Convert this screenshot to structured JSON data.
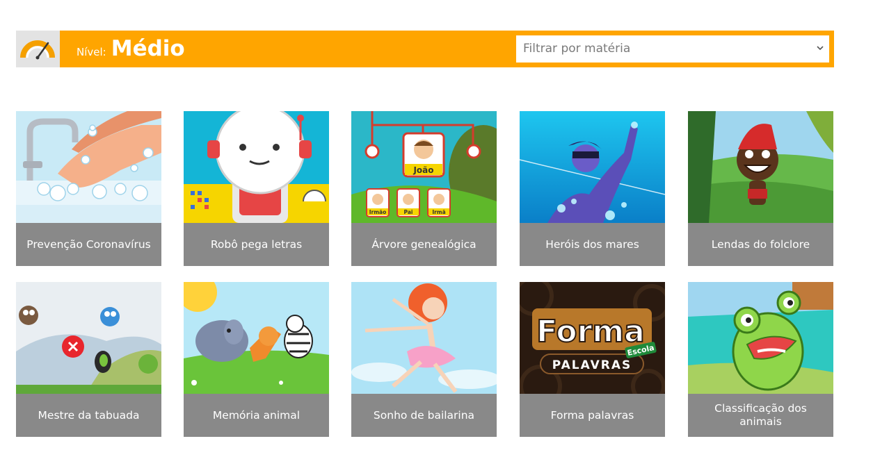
{
  "header": {
    "level_prefix": "Nível:",
    "level_value": "Médio",
    "filter_placeholder": "Filtrar por matéria",
    "accent_color": "#ffa500",
    "icon": "gauge-icon"
  },
  "games": [
    {
      "title": "Prevenção Coronavírus",
      "image": "hand-washing-illustration"
    },
    {
      "title": "Robô pega letras",
      "image": "robot-illustration"
    },
    {
      "title": "Árvore genealógica",
      "image": "family-tree-illustration",
      "labels": [
        "João",
        "Irmão",
        "Pai",
        "Irmã"
      ]
    },
    {
      "title": "Heróis dos mares",
      "image": "sea-hero-illustration"
    },
    {
      "title": "Lendas do folclore",
      "image": "saci-illustration"
    },
    {
      "title": "Mestre da tabuada",
      "image": "flying-birds-illustration"
    },
    {
      "title": "Memória animal",
      "image": "animals-illustration"
    },
    {
      "title": "Sonho de bailarina",
      "image": "ballerina-illustration"
    },
    {
      "title": "Forma palavras",
      "image": "forma-palavras-logo",
      "logo": {
        "line1": "Forma",
        "line2": "PALAVRAS",
        "badge": "Escola"
      }
    },
    {
      "title": "Classificação dos animais",
      "image": "frog-illustration"
    }
  ]
}
